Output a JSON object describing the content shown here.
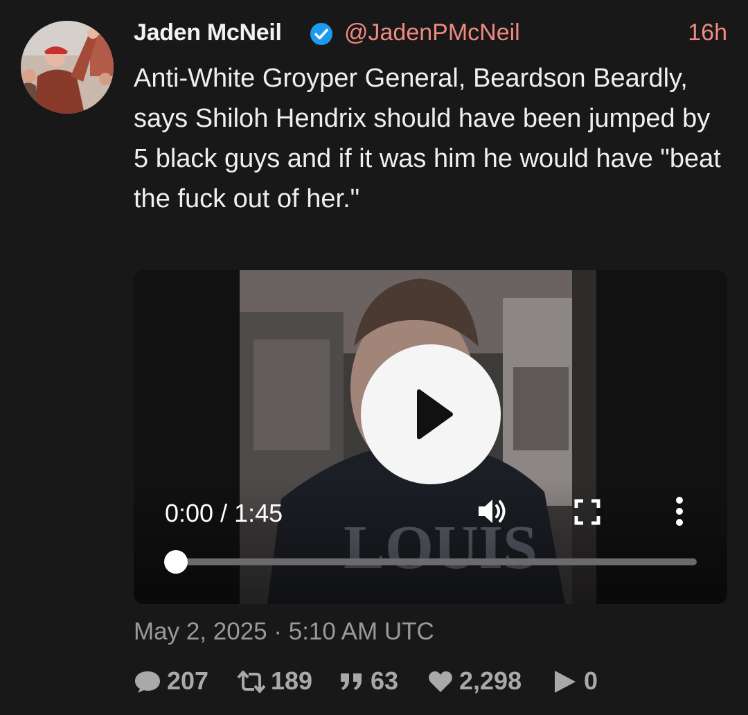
{
  "post": {
    "author_name": "Jaden McNeil",
    "handle": "@JadenPMcNeil",
    "time_ago": "16h",
    "verified": true,
    "text": "Anti-White Groyper General, Beardson Beardly, says Shiloh Hendrix should have been jumped by 5 black guys and if it was him he would have \"beat the fuck out of her.\"",
    "date": "May 2, 2025 · 5:10 AM UTC"
  },
  "video": {
    "time_display": "0:00 / 1:45",
    "progress": 0.0,
    "icons": [
      "play-icon",
      "volume-icon",
      "fullscreen-icon",
      "more-vertical-icon"
    ]
  },
  "stats": {
    "replies": "207",
    "retweets": "189",
    "quotes": "63",
    "likes": "2,298",
    "views": "0"
  },
  "colors": {
    "background": "#181818",
    "accent": "#f08a80",
    "verified": "#1d9bf0",
    "muted": "#9a9a9a"
  }
}
